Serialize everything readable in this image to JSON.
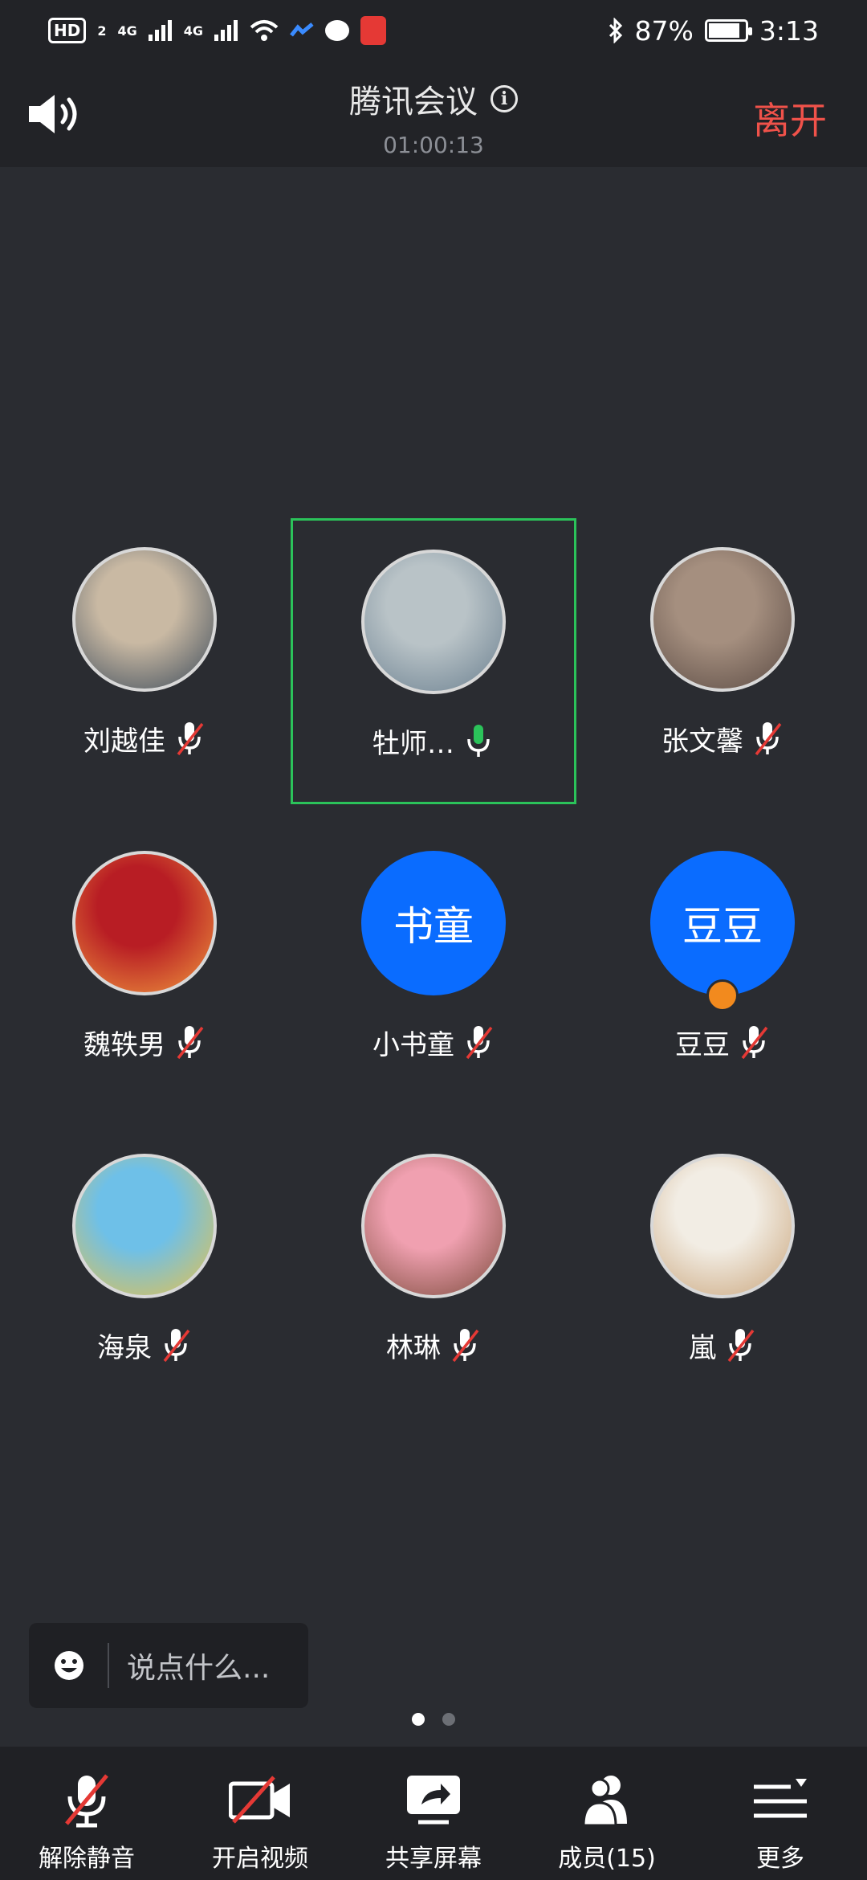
{
  "status_bar": {
    "network_badge": "HD",
    "network_sub": "2",
    "signal1": "4G",
    "signal2": "4G",
    "battery": "87%",
    "time": "3:13",
    "battery_level": 0.87
  },
  "header": {
    "title": "腾讯会议",
    "info_icon": "ⓘ",
    "timer": "01:00:13",
    "leave_label": "离开"
  },
  "participants": [
    {
      "name": "刘越佳",
      "avatar_type": "image",
      "mic": "muted",
      "active": false,
      "avatar_colors": [
        "#c9b9a3",
        "#3b4a5a"
      ]
    },
    {
      "name": "牡师…",
      "avatar_type": "image",
      "mic": "on",
      "active": true,
      "avatar_colors": [
        "#b9c3c7",
        "#6a7f8f"
      ]
    },
    {
      "name": "张文馨",
      "avatar_type": "image",
      "mic": "muted",
      "active": false,
      "avatar_colors": [
        "#a58f7f",
        "#5a4a43"
      ]
    },
    {
      "name": "魏轶男",
      "avatar_type": "image",
      "mic": "muted",
      "active": false,
      "avatar_colors": [
        "#b81d24",
        "#f09a3e"
      ]
    },
    {
      "name": "小书童",
      "avatar_type": "text",
      "avatar_text": "书童",
      "mic": "muted",
      "active": false
    },
    {
      "name": "豆豆",
      "avatar_type": "text",
      "avatar_text": "豆豆",
      "mic": "muted",
      "active": false,
      "host": true
    },
    {
      "name": "海泉",
      "avatar_type": "image",
      "mic": "muted",
      "active": false,
      "avatar_colors": [
        "#6ec0e8",
        "#e8c24a"
      ]
    },
    {
      "name": "林琳",
      "avatar_type": "image",
      "mic": "muted",
      "active": false,
      "avatar_colors": [
        "#f0a0b0",
        "#7a4a3a"
      ]
    },
    {
      "name": "嵐",
      "avatar_type": "image",
      "mic": "muted",
      "active": false,
      "avatar_colors": [
        "#f2ede4",
        "#c9a47a"
      ]
    }
  ],
  "chat": {
    "placeholder": "说点什么..."
  },
  "pager": {
    "total": 2,
    "current": 1
  },
  "toolbar": {
    "unmute_label": "解除静音",
    "video_label": "开启视频",
    "share_label": "共享屏幕",
    "members_label": "成员(15)",
    "more_label": "更多"
  },
  "colors": {
    "background": "#2a2c31",
    "bar": "#202125",
    "active_border": "#2bc35a",
    "leave": "#f0524a",
    "muted_slash": "#e53935",
    "mic_on": "#2bc35a",
    "text_avatar": "#0a6cff",
    "host_badge": "#f28a1e"
  }
}
